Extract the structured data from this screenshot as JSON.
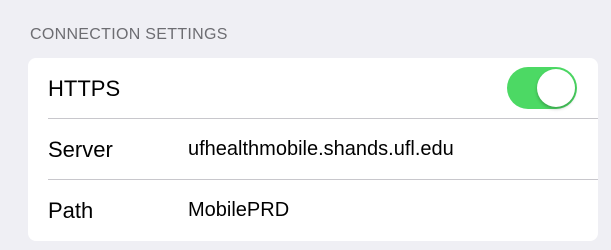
{
  "section": {
    "header": "CONNECTION SETTINGS"
  },
  "rows": {
    "https": {
      "label": "HTTPS",
      "toggle_on": true
    },
    "server": {
      "label": "Server",
      "value": "ufhealthmobile.shands.ufl.edu"
    },
    "path": {
      "label": "Path",
      "value": "MobilePRD"
    }
  },
  "colors": {
    "background": "#efeff4",
    "card": "#ffffff",
    "header_text": "#6d6d72",
    "toggle_on": "#4cd964",
    "separator": "#c8c7cc"
  }
}
